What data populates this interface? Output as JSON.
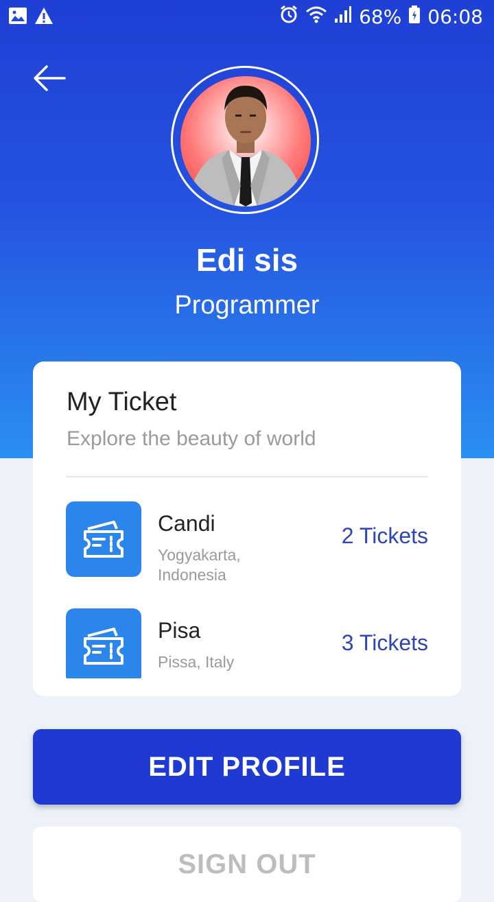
{
  "status_bar": {
    "battery": "68%",
    "time": "06:08",
    "icons": [
      "image-icon",
      "warning-icon",
      "alarm-icon",
      "wifi-icon",
      "signal-icon",
      "battery-icon"
    ]
  },
  "profile": {
    "name": "Edi sis",
    "role": "Programmer"
  },
  "ticket_card": {
    "title": "My Ticket",
    "subtitle": "Explore the beauty of world",
    "items": [
      {
        "name": "Candi",
        "location": "Yogyakarta, Indonesia",
        "count": "2 Tickets"
      },
      {
        "name": "Pisa",
        "location": "Pissa, Italy",
        "count": "3 Tickets"
      }
    ]
  },
  "buttons": {
    "edit_profile": "EDIT PROFILE",
    "sign_out": "SIGN OUT"
  },
  "colors": {
    "primary": "#1f3ad3",
    "accent": "#2a86ea",
    "ticket_count": "#2d45b6"
  }
}
